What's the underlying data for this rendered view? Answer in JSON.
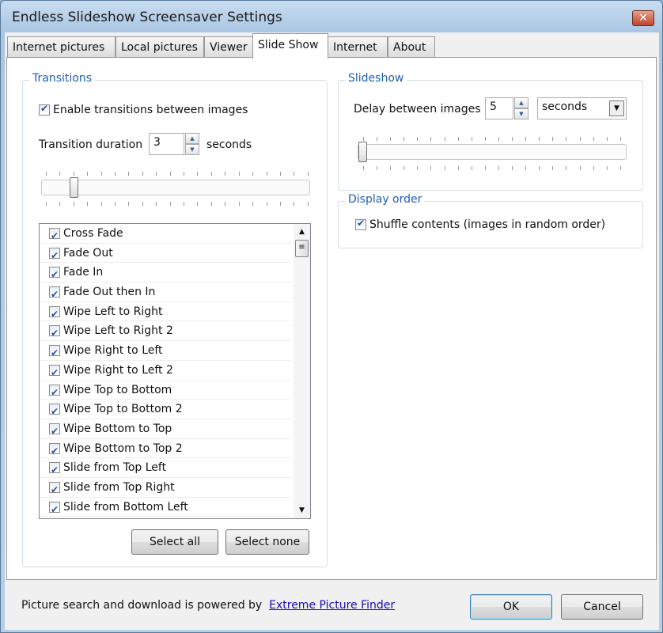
{
  "window": {
    "title": "Endless Slideshow Screensaver Settings",
    "close_icon": "close-x-icon"
  },
  "tabs": [
    {
      "label": "Internet pictures"
    },
    {
      "label": "Local pictures"
    },
    {
      "label": "Viewer"
    },
    {
      "label": "Slide Show",
      "active": true
    },
    {
      "label": "Internet"
    },
    {
      "label": "About"
    }
  ],
  "transitions": {
    "group_label": "Transitions",
    "enable_label": "Enable transitions between images",
    "enable_checked": true,
    "duration_label": "Transition duration",
    "duration_value": "3",
    "duration_unit": "seconds",
    "slider_value": 3,
    "slider_range": [
      1,
      20
    ],
    "items": [
      {
        "label": "Cross Fade",
        "checked": true
      },
      {
        "label": "Fade Out",
        "checked": true
      },
      {
        "label": "Fade In",
        "checked": true
      },
      {
        "label": "Fade Out then In",
        "checked": true
      },
      {
        "label": "Wipe Left to Right",
        "checked": true
      },
      {
        "label": "Wipe Left to Right 2",
        "checked": true
      },
      {
        "label": "Wipe Right to Left",
        "checked": true
      },
      {
        "label": "Wipe Right to Left 2",
        "checked": true
      },
      {
        "label": "Wipe Top to Bottom",
        "checked": true
      },
      {
        "label": "Wipe Top to Bottom 2",
        "checked": true
      },
      {
        "label": "Wipe Bottom to Top",
        "checked": true
      },
      {
        "label": "Wipe Bottom to Top 2",
        "checked": true
      },
      {
        "label": "Slide from Top Left",
        "checked": true
      },
      {
        "label": "Slide from Top Right",
        "checked": true
      },
      {
        "label": "Slide from Bottom Left",
        "checked": true
      }
    ],
    "select_all": "Select all",
    "select_none": "Select none"
  },
  "slideshow": {
    "group_label": "Slideshow",
    "delay_label": "Delay between images",
    "delay_value": "5",
    "delay_unit": "seconds",
    "slider_value": 5,
    "slider_range": [
      5,
      60
    ]
  },
  "display_order": {
    "group_label": "Display order",
    "shuffle_label": "Shuffle contents (images in random order)",
    "shuffle_checked": true
  },
  "footer": {
    "powered_text": "Picture search and download is powered by",
    "link_text": "Extreme Picture Finder",
    "ok": "OK",
    "cancel": "Cancel"
  }
}
